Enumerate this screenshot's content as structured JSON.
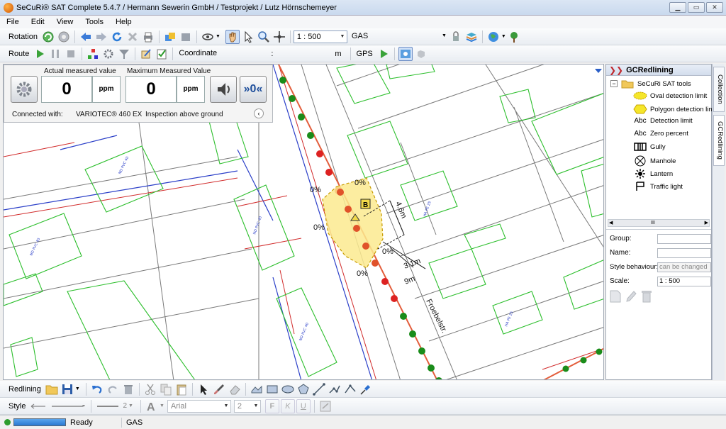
{
  "window": {
    "title": "SeCuRi® SAT Complete 5.4.7 / Hermann Sewerin GmbH / Testprojekt / Lutz Hörnschemeyer"
  },
  "menu": [
    "File",
    "Edit",
    "View",
    "Tools",
    "Help"
  ],
  "toolbar1": {
    "rotation_label": "Rotation",
    "scale_value": "1 : 500",
    "layer_value": "GAS"
  },
  "toolbar2": {
    "route_label": "Route",
    "coordinate_label": "Coordinate",
    "coord_sep": ":",
    "unit_m": "m",
    "gps_label": "GPS"
  },
  "measurement": {
    "actual_label": "Actual measured value",
    "max_label": "Maximum Measured Value",
    "actual_value": "0",
    "max_value": "0",
    "unit": "ppm",
    "connected_label": "Connected with:",
    "device": "VARIOTEC® 460 EX",
    "mode": "Inspection above ground",
    "zero_button": "»0«"
  },
  "map": {
    "street": "Froebelstr.",
    "percent_labels": [
      "0%",
      "0%",
      "0%",
      "0%",
      "0%"
    ],
    "dims": [
      "4.6m",
      "3.1m",
      "9m"
    ],
    "marker": "B",
    "parcel_labels": [
      "ND PVC 40",
      "HA PE 25",
      "ND PVC 40",
      "HA PE 32",
      "ND PVC 40",
      "HA PE 25"
    ],
    "colors": {
      "building": "#2dbf2d",
      "parcel": "#7a7a7a",
      "red_line": "#d12b2b",
      "blue_line": "#2b3fc8",
      "gas_main": "#e35d3b"
    }
  },
  "panel": {
    "title": "GCRedlining",
    "root": "SeCuRi SAT tools",
    "items": [
      {
        "icon": "oval-icon",
        "label": "Oval detection limit"
      },
      {
        "icon": "polygon-icon",
        "label": "Polygon detection limit"
      },
      {
        "icon": "abc-icon",
        "label": "Detection limit",
        "glyph": "Abc"
      },
      {
        "icon": "abc-icon",
        "label": "Zero percent",
        "glyph": "Abc"
      },
      {
        "icon": "gully-icon",
        "label": "Gully"
      },
      {
        "icon": "manhole-icon",
        "label": "Manhole"
      },
      {
        "icon": "lantern-icon",
        "label": "Lantern"
      },
      {
        "icon": "traffic-light-icon",
        "label": "Traffic light"
      }
    ],
    "scroll_mark": "III",
    "group_label": "Group:",
    "name_label": "Name:",
    "style_behaviour_label": "Style behaviour:",
    "style_behaviour_value": "can be changed",
    "scale_label": "Scale:",
    "scale_value": "1 : 500",
    "tabs": [
      "Collection",
      "GCRedlining"
    ]
  },
  "toolbar3": {
    "redlining_label": "Redlining"
  },
  "toolbar4": {
    "style_label": "Style",
    "line_width": "2",
    "font": "Arial",
    "font_size": "2",
    "bold": "F",
    "italic": "K",
    "underline": "U"
  },
  "status": {
    "ready": "Ready",
    "layer": "GAS"
  }
}
